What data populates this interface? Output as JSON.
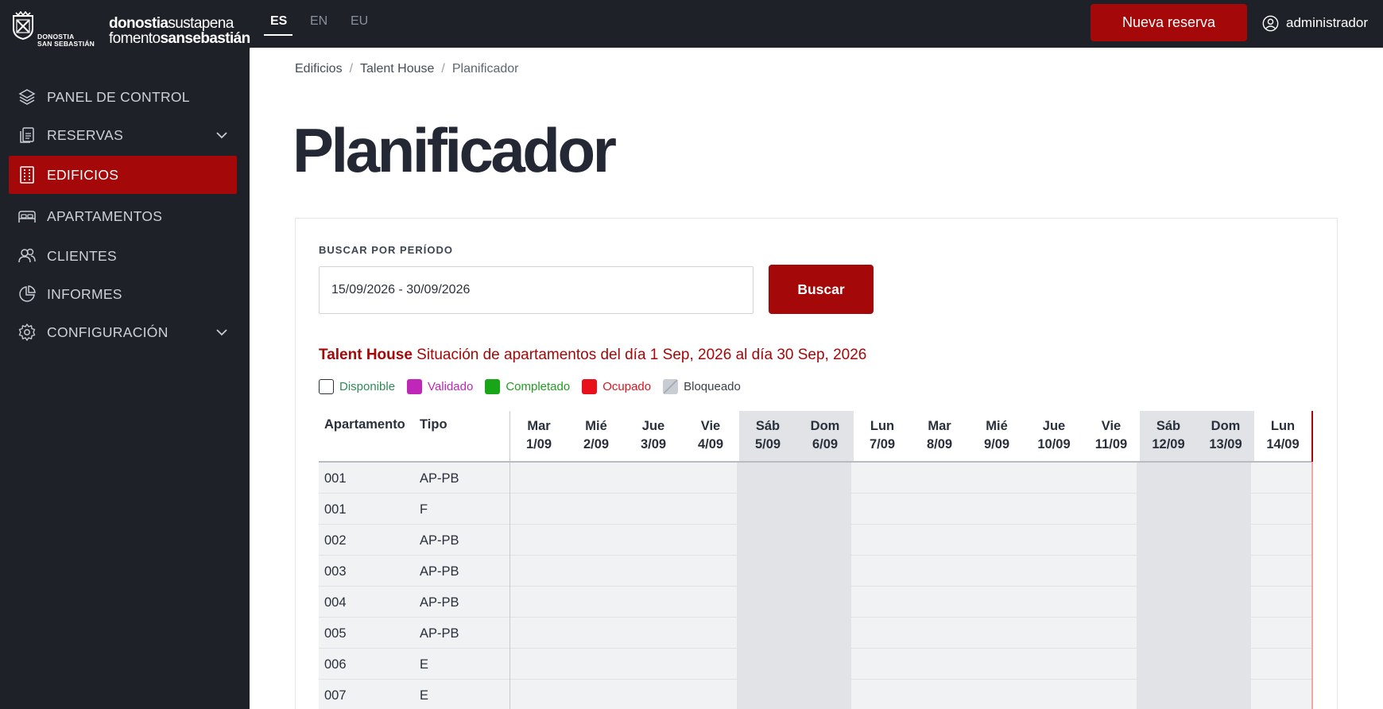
{
  "header": {
    "logo": {
      "city_line1": "DONOSTIA",
      "city_line2": "SAN SEBASTIÁN",
      "icon": "city-shield-icon"
    },
    "brand": {
      "line1_bold": "donostia",
      "line1_light": "sustapena",
      "line2_light": "fomento",
      "line2_bold": "sansebastián"
    },
    "languages": [
      {
        "code": "ES",
        "active": true
      },
      {
        "code": "EN",
        "active": false
      },
      {
        "code": "EU",
        "active": false
      }
    ],
    "new_booking_label": "Nueva reserva",
    "user_name": "administrador",
    "user_icon": "user-circle-icon"
  },
  "sidebar": {
    "items": [
      {
        "label": "PANEL DE CONTROL",
        "icon": "layers-icon",
        "active": false,
        "expandable": false
      },
      {
        "label": "RESERVAS",
        "icon": "documents-icon",
        "active": false,
        "expandable": true
      },
      {
        "label": "EDIFICIOS",
        "icon": "building-icon",
        "active": true,
        "expandable": false
      },
      {
        "label": "APARTAMENTOS",
        "icon": "bed-icon",
        "active": false,
        "expandable": false
      },
      {
        "label": "CLIENTES",
        "icon": "users-icon",
        "active": false,
        "expandable": false
      },
      {
        "label": "INFORMES",
        "icon": "pie-chart-icon",
        "active": false,
        "expandable": false
      },
      {
        "label": "CONFIGURACIÓN",
        "icon": "gear-icon",
        "active": false,
        "expandable": true
      }
    ]
  },
  "breadcrumb": [
    "Edificios",
    "Talent House",
    "Planificador"
  ],
  "page_title": "Planificador",
  "search": {
    "label": "BUSCAR POR PERÍODO",
    "value": "15/09/2026 - 30/09/2026",
    "button_label": "Buscar"
  },
  "situation": {
    "building": "Talent House",
    "text": "Situación de apartamentos del día 1 Sep, 2026 al día 30 Sep, 2026"
  },
  "legend": [
    {
      "label": "Disponible",
      "color": "#2e8b57",
      "swatch": "#ffffff",
      "border": "#2a2f38"
    },
    {
      "label": "Validado",
      "color": "#c026b8",
      "swatch": "#c026b8",
      "border": "#c026b8"
    },
    {
      "label": "Completado",
      "color": "#1f9e1f",
      "swatch": "#18a518",
      "border": "#18a518"
    },
    {
      "label": "Ocupado",
      "color": "#e0141c",
      "swatch": "#e8101a",
      "border": "#e8101a"
    },
    {
      "label": "Bloqueado",
      "color": "#3a3f48",
      "swatch": "#b9bec6",
      "border": "#b9bec6"
    }
  ],
  "planner": {
    "col_apartment": "Apartamento",
    "col_type": "Tipo",
    "days": [
      {
        "weekday": "Mar",
        "date": "1/09",
        "weekend": false
      },
      {
        "weekday": "Mié",
        "date": "2/09",
        "weekend": false
      },
      {
        "weekday": "Jue",
        "date": "3/09",
        "weekend": false
      },
      {
        "weekday": "Vie",
        "date": "4/09",
        "weekend": false
      },
      {
        "weekday": "Sáb",
        "date": "5/09",
        "weekend": true
      },
      {
        "weekday": "Dom",
        "date": "6/09",
        "weekend": true
      },
      {
        "weekday": "Lun",
        "date": "7/09",
        "weekend": false
      },
      {
        "weekday": "Mar",
        "date": "8/09",
        "weekend": false
      },
      {
        "weekday": "Mié",
        "date": "9/09",
        "weekend": false
      },
      {
        "weekday": "Jue",
        "date": "10/09",
        "weekend": false
      },
      {
        "weekday": "Vie",
        "date": "11/09",
        "weekend": false
      },
      {
        "weekday": "Sáb",
        "date": "12/09",
        "weekend": true
      },
      {
        "weekday": "Dom",
        "date": "13/09",
        "weekend": true
      },
      {
        "weekday": "Lun",
        "date": "14/09",
        "weekend": false
      }
    ],
    "rows": [
      {
        "apartment": "001",
        "type": "AP-PB"
      },
      {
        "apartment": "001",
        "type": "F"
      },
      {
        "apartment": "002",
        "type": "AP-PB"
      },
      {
        "apartment": "003",
        "type": "AP-PB"
      },
      {
        "apartment": "004",
        "type": "AP-PB"
      },
      {
        "apartment": "005",
        "type": "AP-PB"
      },
      {
        "apartment": "006",
        "type": "E"
      },
      {
        "apartment": "007",
        "type": "E"
      }
    ]
  },
  "colors": {
    "accent": "#a40808",
    "sidebar_bg": "#1e2128",
    "weekend_bg": "#e1e3e7",
    "row_bg": "#f1f2f4"
  }
}
